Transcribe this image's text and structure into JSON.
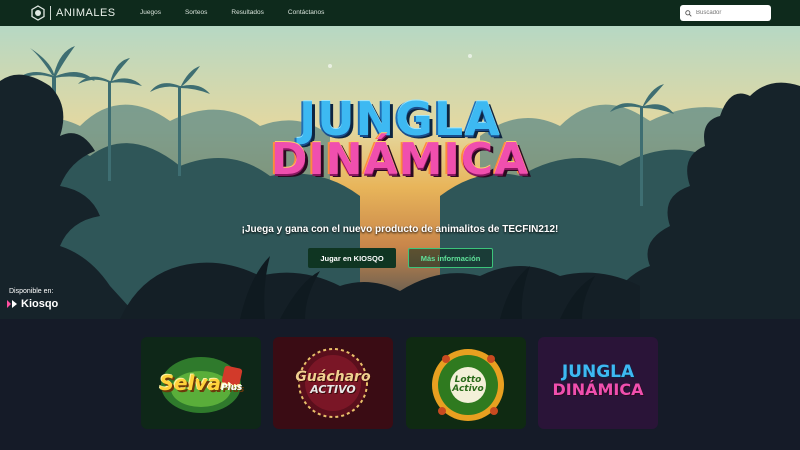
{
  "nav": {
    "logo_text": "ANIMALES",
    "menu": [
      "Juegos",
      "Sorteos",
      "Resultados",
      "Contáctanos"
    ],
    "search_placeholder": "Buscador"
  },
  "hero": {
    "title_line1": "JUNGLA",
    "title_line2": "DINÁMICA",
    "tagline": "¡Juega y gana con el nuevo producto de animalitos de TECFIN212!",
    "primary_button": "Jugar en KIOSQO",
    "secondary_button": "Más información",
    "available_label": "Disponible en:",
    "available_brand": "Kiosqo"
  },
  "games": [
    {
      "name_line1": "Selva",
      "name_line2": "Plus"
    },
    {
      "name_line1": "Guácharo",
      "name_line2": "ACTIVO"
    },
    {
      "name_line1": "Lotto",
      "name_line2": "Activo"
    },
    {
      "name_line1": "JUNGLA",
      "name_line2": "DINÁMICA"
    }
  ],
  "colors": {
    "nav_bg": "#0e2a1c",
    "accent_green": "#3cc47a",
    "page_bg": "#151b28",
    "title_blue": "#3db9f2",
    "title_pink": "#f04fae"
  }
}
